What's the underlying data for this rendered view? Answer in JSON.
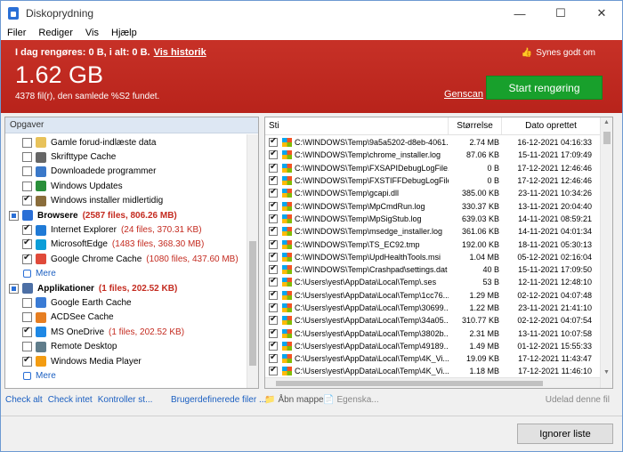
{
  "window": {
    "title": "Diskoprydning",
    "btn_min": "—",
    "btn_max": "☐",
    "btn_close": "✕"
  },
  "menu": [
    "Filer",
    "Rediger",
    "Vis",
    "Hjælp"
  ],
  "banner": {
    "line1": "I dag rengøres: 0 B, i alt: 0 B.",
    "history_link": "Vis historik",
    "size": "1.62 GB",
    "subtitle": "4378 fil(r), den samlede %S2 fundet.",
    "like": "Synes godt om",
    "genscan": "Genscan",
    "start": "Start rengøring",
    "color": "#c42b20"
  },
  "left": {
    "header": "Opgaver",
    "items": [
      {
        "type": "sub",
        "label": "Gamle forud-indlæste data",
        "checked": false,
        "icon": "folder-icon"
      },
      {
        "type": "sub",
        "label": "Skrifttype Cache",
        "checked": false,
        "icon": "font-icon"
      },
      {
        "type": "sub",
        "label": "Downloadede programmer",
        "checked": false,
        "icon": "download-icon"
      },
      {
        "type": "sub",
        "label": "Windows Updates",
        "checked": false,
        "icon": "update-icon"
      },
      {
        "type": "sub",
        "label": "Windows installer midlertidig",
        "checked": true,
        "icon": "installer-icon"
      },
      {
        "type": "group",
        "label": "Browsere",
        "detail": "(2587 files, 806.26 MB)",
        "partial": true,
        "icon": "globe-icon"
      },
      {
        "type": "sub",
        "label": "Internet Explorer",
        "detail": "(24 files, 370.31 KB)",
        "checked": true,
        "icon": "ie-icon"
      },
      {
        "type": "sub",
        "label": "MicrosoftEdge",
        "detail": "(1483 files, 368.30 MB)",
        "checked": true,
        "icon": "edge-icon"
      },
      {
        "type": "sub",
        "label": "Google Chrome Cache",
        "detail": "(1080 files, 437.60 MB)",
        "checked": true,
        "icon": "chrome-icon"
      },
      {
        "type": "more",
        "label": "Mere",
        "icon": "plus-icon"
      },
      {
        "type": "group",
        "label": "Applikationer",
        "detail": "(1 files, 202.52 KB)",
        "partial": true,
        "icon": "apps-icon"
      },
      {
        "type": "sub",
        "label": "Google Earth Cache",
        "checked": false,
        "icon": "earth-icon"
      },
      {
        "type": "sub",
        "label": "ACDSee Cache",
        "checked": false,
        "icon": "acdsee-icon"
      },
      {
        "type": "sub",
        "label": "MS OneDrive",
        "detail": "(1 files, 202.52 KB)",
        "checked": true,
        "icon": "onedrive-icon"
      },
      {
        "type": "sub",
        "label": "Remote Desktop",
        "checked": false,
        "icon": "remote-icon"
      },
      {
        "type": "sub",
        "label": "Windows Media Player",
        "checked": true,
        "icon": "media-icon"
      },
      {
        "type": "more",
        "label": "Mere",
        "icon": "plus-icon"
      }
    ]
  },
  "table": {
    "columns": [
      "Sti",
      "Størrelse",
      "Dato oprettet"
    ],
    "rows": [
      [
        "C:\\WINDOWS\\Temp\\9a5a5202-d8eb-4061...",
        "2.74 MB",
        "16-12-2021 04:16:33"
      ],
      [
        "C:\\WINDOWS\\Temp\\chrome_installer.log",
        "87.06 KB",
        "15-11-2021 17:09:49"
      ],
      [
        "C:\\WINDOWS\\Temp\\FXSAPIDebugLogFile...",
        "0 B",
        "17-12-2021 12:46:46"
      ],
      [
        "C:\\WINDOWS\\Temp\\FXSTIFFDebugLogFile...",
        "0 B",
        "17-12-2021 12:46:46"
      ],
      [
        "C:\\WINDOWS\\Temp\\gcapi.dll",
        "385.00 KB",
        "23-11-2021 10:34:26"
      ],
      [
        "C:\\WINDOWS\\Temp\\MpCmdRun.log",
        "330.37 KB",
        "13-11-2021 20:04:40"
      ],
      [
        "C:\\WINDOWS\\Temp\\MpSigStub.log",
        "639.03 KB",
        "14-11-2021 08:59:21"
      ],
      [
        "C:\\WINDOWS\\Temp\\msedge_installer.log",
        "361.06 KB",
        "14-11-2021 04:01:34"
      ],
      [
        "C:\\WINDOWS\\Temp\\TS_EC92.tmp",
        "192.00 KB",
        "18-11-2021 05:30:13"
      ],
      [
        "C:\\WINDOWS\\Temp\\UpdHealthTools.msi",
        "1.04 MB",
        "05-12-2021 02:16:04"
      ],
      [
        "C:\\WINDOWS\\Temp\\Crashpad\\settings.dat",
        "40 B",
        "15-11-2021 17:09:50"
      ],
      [
        "C:\\Users\\yest\\AppData\\Local\\Temp\\.ses",
        "53 B",
        "12-11-2021 12:48:10"
      ],
      [
        "C:\\Users\\yest\\AppData\\Local\\Temp\\1cc76...",
        "1.29 MB",
        "02-12-2021 04:07:48"
      ],
      [
        "C:\\Users\\yest\\AppData\\Local\\Temp\\30699...",
        "1.22 MB",
        "23-11-2021 21:41:10"
      ],
      [
        "C:\\Users\\yest\\AppData\\Local\\Temp\\34a05...",
        "310.77 KB",
        "02-12-2021 04:07:54"
      ],
      [
        "C:\\Users\\yest\\AppData\\Local\\Temp\\3802b...",
        "2.31 MB",
        "13-11-2021 10:07:58"
      ],
      [
        "C:\\Users\\yest\\AppData\\Local\\Temp\\49189...",
        "1.49 MB",
        "01-12-2021 15:55:33"
      ],
      [
        "C:\\Users\\yest\\AppData\\Local\\Temp\\4K_Vi...",
        "19.09 KB",
        "17-12-2021 11:43:47"
      ],
      [
        "C:\\Users\\yest\\AppData\\Local\\Temp\\4K_Vi...",
        "1.18 MB",
        "17-12-2021 11:46:10"
      ],
      [
        "C:\\Users\\yest\\AppData\\Local\\Temp\\5ffa3...",
        "21.52 KB",
        "24-11-2021 03:21:24"
      ],
      [
        "C:\\Users\\yest\\AppData\\Local\\Temp\\7c341...",
        "37.42 KB",
        "13-11-2021 19:23:45"
      ]
    ]
  },
  "bottom": {
    "check_all": "Check alt",
    "check_none": "Check intet",
    "kontroller": "Kontroller st...",
    "brugerdefinerede": "Brugerdefinerede filer ...",
    "aabn": "Åbn mappe",
    "egenska": "Egenska...",
    "udelad": "Udelad denne fil",
    "ignorer": "Ignorer liste"
  }
}
